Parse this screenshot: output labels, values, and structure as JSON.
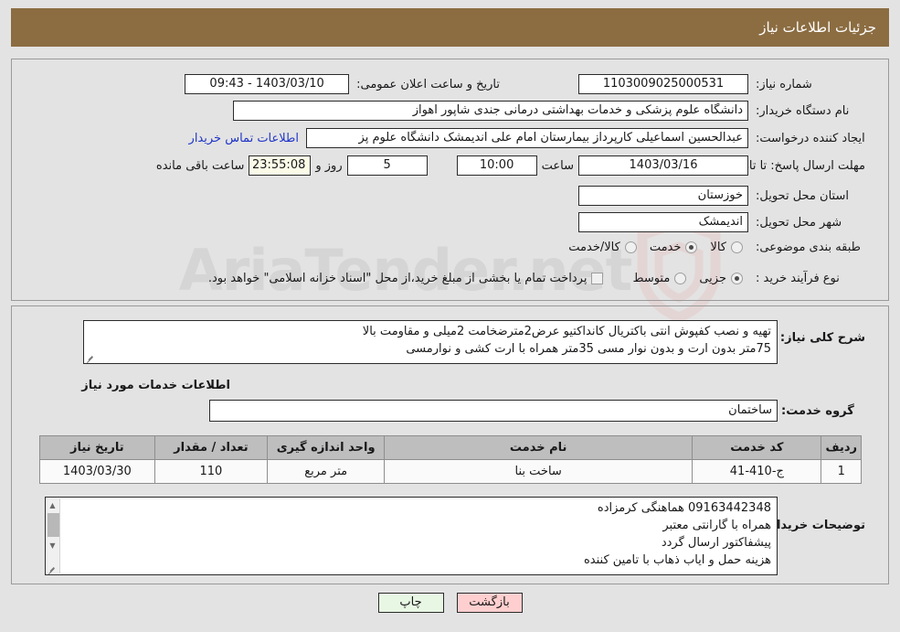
{
  "header": {
    "title": "جزئیات اطلاعات نیاز",
    "bg_color": "#8c6d42"
  },
  "watermark": {
    "text": "AriaTender.net"
  },
  "form": {
    "need_number": {
      "label": "شماره نیاز:",
      "value": "1103009025000531"
    },
    "announce_datetime": {
      "label": "تاریخ و ساعت اعلان عمومی:",
      "value": "1403/03/10 - 09:43"
    },
    "buyer_org": {
      "label": "نام دستگاه خریدار:",
      "value": "دانشگاه علوم پزشکی و خدمات بهداشتی درمانی جندی شاپور اهواز"
    },
    "requester": {
      "label": "ایجاد کننده درخواست:",
      "value": "عبدالحسین اسماعیلی کارپرداز بیمارستان امام علی اندیمشک دانشگاه علوم پز",
      "contact_link": "اطلاعات تماس خریدار"
    },
    "deadline": {
      "label": "مهلت ارسال پاسخ: تا تاریخ:",
      "date": "1403/03/16",
      "time_label": "ساعت",
      "time": "10:00",
      "days": "5",
      "days_label": "روز و",
      "countdown": "23:55:08",
      "countdown_label": "ساعت باقی مانده"
    },
    "province": {
      "label": "استان محل تحویل:",
      "value": "خوزستان"
    },
    "city": {
      "label": "شهر محل تحویل:",
      "value": "اندیمشک"
    },
    "category": {
      "label": "طبقه بندی موضوعی:",
      "options": [
        {
          "label": "کالا",
          "selected": false
        },
        {
          "label": "خدمت",
          "selected": true
        },
        {
          "label": "کالا/خدمت",
          "selected": false
        }
      ]
    },
    "purchase_type": {
      "label": "نوع فرآیند خرید :",
      "options": [
        {
          "label": "جزیی",
          "selected": true
        },
        {
          "label": "متوسط",
          "selected": false
        }
      ],
      "treasury_checkbox": {
        "label": "پرداخت تمام یا بخشی از مبلغ خرید،از محل \"اسناد خزانه اسلامی\" خواهد بود.",
        "checked": false
      }
    },
    "general_desc": {
      "label": "شرح کلی نیاز:",
      "value": "تهیه و نصب کفپوش انتی باکتریال کانداکتیو عرض2مترضخامت 2میلی و مقاومت بالا\n75متر بدون ارت و بدون نوار مسی 35متر همراه با ارت کشی و نوارمسی"
    },
    "services_section_title": "اطلاعات خدمات مورد نیاز",
    "service_group": {
      "label": "گروه خدمت:",
      "value": "ساختمان"
    }
  },
  "table": {
    "columns": [
      "ردیف",
      "کد خدمت",
      "نام خدمت",
      "واحد اندازه گیری",
      "تعداد / مقدار",
      "تاریخ نیاز"
    ],
    "rows": [
      [
        "1",
        "ج-410-41",
        "ساخت بنا",
        "متر مربع",
        "110",
        "1403/03/30"
      ]
    ]
  },
  "buyer_notes": {
    "label": "توضیحات خریدار:",
    "value": "09163442348 هماهنگی کرمزاده\nهمراه با گارانتی معتبر\nپیشفاکتور ارسال گردد\nهزینه حمل و ایاب ذهاب با تامین کننده"
  },
  "footer": {
    "print_label": "چاپ",
    "back_label": "بازگشت"
  }
}
